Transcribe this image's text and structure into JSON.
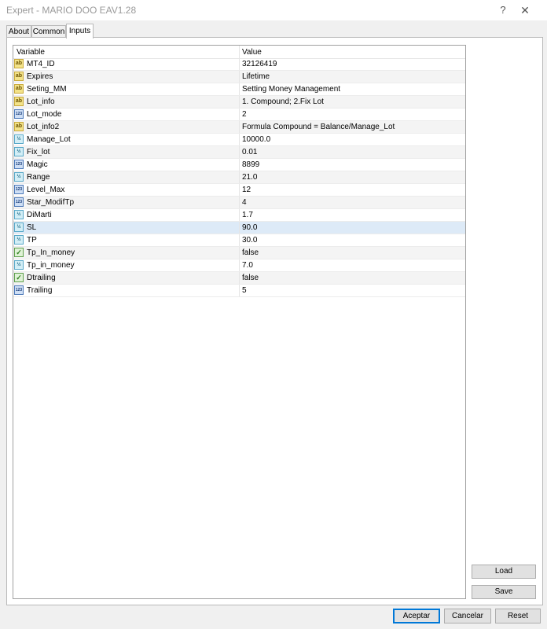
{
  "window": {
    "title": "Expert - MARIO DOO EAV1.28",
    "help_symbol": "?",
    "close_symbol": "✕"
  },
  "tabs": [
    {
      "label": "About"
    },
    {
      "label": "Common"
    },
    {
      "label": "Inputs"
    }
  ],
  "grid": {
    "columns": {
      "variable": "Variable",
      "value": "Value"
    },
    "rows": [
      {
        "icon": "string-icon",
        "glyph": "ab",
        "variable": "MT4_ID",
        "value": "32126419"
      },
      {
        "icon": "string-icon",
        "glyph": "ab",
        "variable": "Expires",
        "value": "Lifetime"
      },
      {
        "icon": "string-icon",
        "glyph": "ab",
        "variable": "Seting_MM",
        "value": "Setting Money Management"
      },
      {
        "icon": "string-icon",
        "glyph": "ab",
        "variable": "Lot_info",
        "value": "1. Compound; 2.Fix Lot"
      },
      {
        "icon": "integer-icon",
        "glyph": "123",
        "variable": "Lot_mode",
        "value": "2"
      },
      {
        "icon": "string-icon",
        "glyph": "ab",
        "variable": "Lot_info2",
        "value": "Formula Compound = Balance/Manage_Lot"
      },
      {
        "icon": "double-icon",
        "glyph": "½",
        "variable": "Manage_Lot",
        "value": "10000.0"
      },
      {
        "icon": "double-icon",
        "glyph": "½",
        "variable": "Fix_lot",
        "value": "0.01"
      },
      {
        "icon": "integer-icon",
        "glyph": "123",
        "variable": "Magic",
        "value": "8899"
      },
      {
        "icon": "double-icon",
        "glyph": "½",
        "variable": "Range",
        "value": "21.0"
      },
      {
        "icon": "integer-icon",
        "glyph": "123",
        "variable": "Level_Max",
        "value": "12"
      },
      {
        "icon": "integer-icon",
        "glyph": "123",
        "variable": "Star_ModifTp",
        "value": "4"
      },
      {
        "icon": "double-icon",
        "glyph": "½",
        "variable": "DiMarti",
        "value": "1.7"
      },
      {
        "icon": "double-icon",
        "glyph": "½",
        "variable": "SL",
        "value": "90.0"
      },
      {
        "icon": "double-icon",
        "glyph": "½",
        "variable": "TP",
        "value": "30.0"
      },
      {
        "icon": "boolean-icon",
        "glyph": "✓",
        "variable": "Tp_In_money",
        "value": "false"
      },
      {
        "icon": "double-icon",
        "glyph": "½",
        "variable": "Tp_in_money",
        "value": "7.0"
      },
      {
        "icon": "boolean-icon",
        "glyph": "✓",
        "variable": "Dtrailing",
        "value": "false"
      },
      {
        "icon": "integer-icon",
        "glyph": "123",
        "variable": "Trailing",
        "value": "5"
      }
    ]
  },
  "side_buttons": {
    "load": "Load",
    "save": "Save"
  },
  "bottom_buttons": {
    "accept": "Aceptar",
    "cancel": "Cancelar",
    "reset": "Reset"
  }
}
